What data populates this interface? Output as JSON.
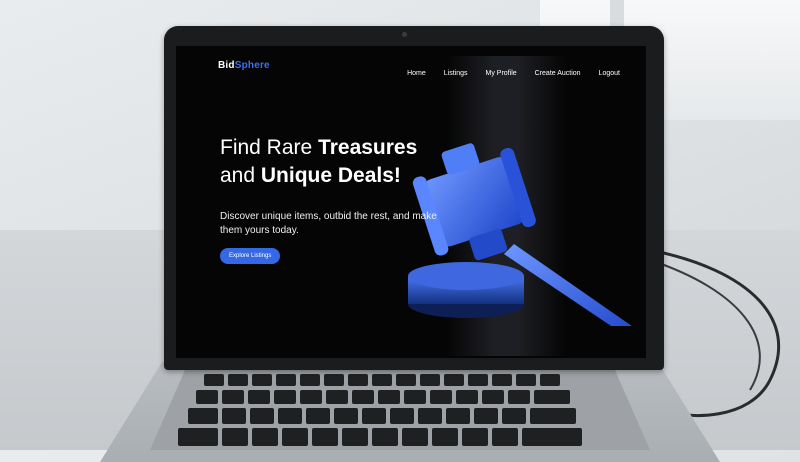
{
  "brand": {
    "part1": "Bid",
    "part2": "Sphere"
  },
  "nav": {
    "items": [
      "Home",
      "Listings",
      "My Profile",
      "Create Auction",
      "Logout"
    ]
  },
  "hero": {
    "title_light_1": "Find Rare ",
    "title_bold_1": "Treasures",
    "title_light_2": "and ",
    "title_bold_2": "Unique Deals!",
    "subtitle": "Discover unique items, outbid the rest, and make them yours today.",
    "cta_label": "Explore Listings"
  },
  "colors": {
    "accent": "#3568e6",
    "brand_accent": "#3f6fe8",
    "screen_bg": "#050505"
  },
  "icons": {
    "hero_image": "auction-gavel-icon"
  }
}
